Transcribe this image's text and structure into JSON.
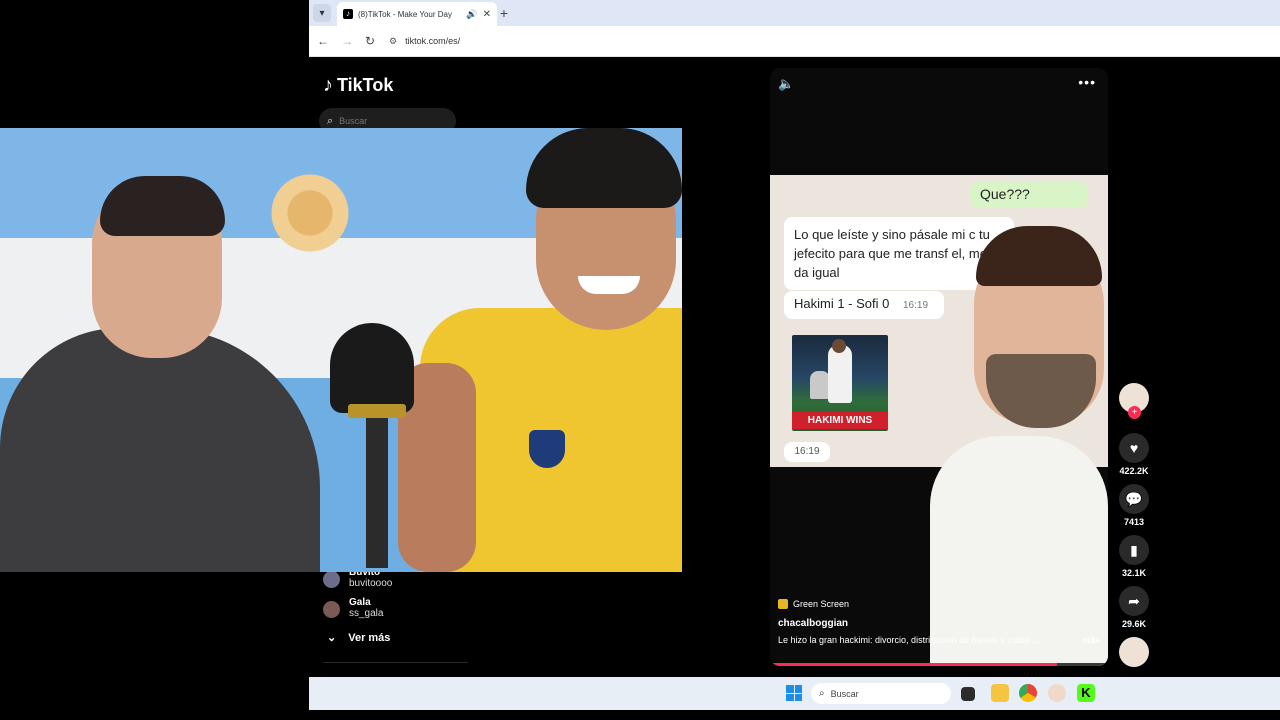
{
  "browser": {
    "tab_title": "(8)TikTok - Make Your Day",
    "url": "tiktok.com/es/"
  },
  "tiktok": {
    "logo": "TikTok",
    "search_placeholder": "Buscar",
    "following": [
      {
        "name": "Buvito",
        "handle": "buvitoooo"
      },
      {
        "name": "Gala",
        "handle": "ss_gala"
      }
    ],
    "see_more": "Ver más"
  },
  "video": {
    "chat": {
      "outgoing": "Que???",
      "incoming_1": "Lo que leíste y sino pásale mi c tu jefecito para que me transf el, me da igual",
      "incoming_2": "Hakimi 1 - Sofi 0",
      "time_1": "16:19",
      "photo_banner": "HAKIMI WINS",
      "time_2": "16:19"
    },
    "tag": "Green Screen",
    "author": "chacalboggian",
    "description": "Le hizo la gran hackimi: divorcio, distribución de bienes y cuota ...",
    "more_label": "más",
    "progress": 0.85
  },
  "actions": {
    "likes": "422.2K",
    "comments": "7413",
    "saves": "32.1K",
    "shares": "29.6K"
  },
  "taskbar": {
    "search_label": "Buscar"
  },
  "colors": {
    "accent": "#fe2c55",
    "background": "#000000"
  }
}
